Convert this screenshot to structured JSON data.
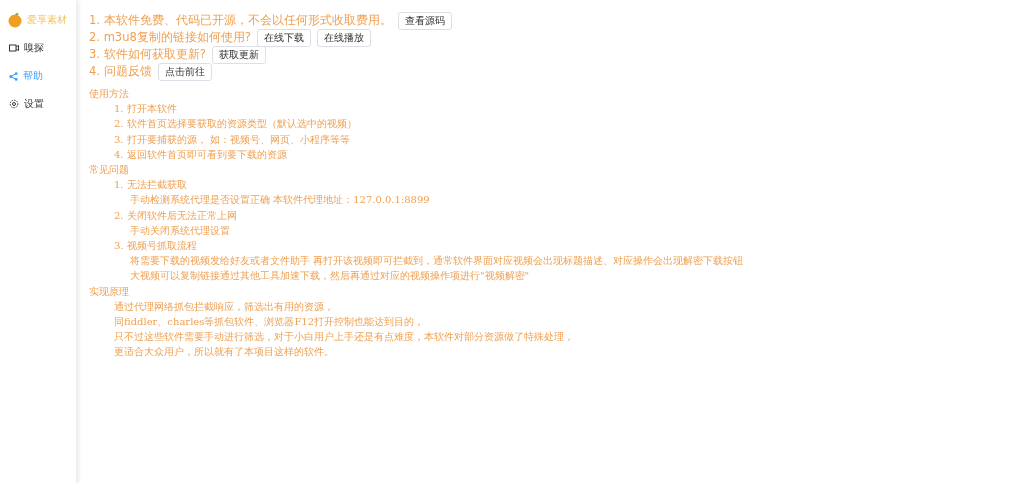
{
  "sidebar": {
    "logo_text": "爱享素材",
    "items": [
      {
        "label": "嗅探",
        "selected": false
      },
      {
        "label": "帮助",
        "selected": true
      },
      {
        "label": "设置",
        "selected": false
      }
    ]
  },
  "faq": [
    {
      "text": "1. 本软件免费、代码已开源，不会以任何形式收取费用。",
      "buttons": [
        "查看源码"
      ]
    },
    {
      "text": "2. m3u8复制的链接如何使用?",
      "buttons": [
        "在线下载",
        "在线播放"
      ]
    },
    {
      "text": "3. 软件如何获取更新?",
      "buttons": [
        "获取更新"
      ]
    },
    {
      "text": "4. 问题反馈",
      "buttons": [
        "点击前往"
      ]
    }
  ],
  "guide": [
    {
      "title": "使用方法",
      "items": [
        {
          "text": "1. 打开本软件"
        },
        {
          "text": "2. 软件首页选择要获取的资源类型（默认选中的视频）"
        },
        {
          "text": "3. 打开要捕获的源， 如：视频号、网页、小程序等等"
        },
        {
          "text": "4. 返回软件首页即可看到要下载的资源"
        }
      ]
    },
    {
      "title": "常见问题",
      "items": [
        {
          "text": "1. 无法拦截获取",
          "notes": [
            "手动检测系统代理是否设置正确 本软件代理地址：127.0.0.1:8899"
          ]
        },
        {
          "text": "2. 关闭软件后无法正常上网",
          "notes": [
            "手动关闭系统代理设置"
          ]
        },
        {
          "text": "3. 视频号抓取流程",
          "notes": [
            "将需要下载的视频发给好友或者文件助手 再打开该视频即可拦截到，通常软件界面对应视频会出现标题描述、对应操作会出现解密下载按钮",
            "大视频可以复制链接通过其他工具加速下载，然后再通过对应的视频操作项进行\"视频解密\""
          ]
        }
      ]
    },
    {
      "title": "实现原理",
      "lines": [
        "通过代理网络抓包拦截响应，筛选出有用的资源，",
        "同fiddler、charles等抓包软件、浏览器F12打开控制也能达到目的，",
        "只不过这些软件需要手动进行筛选，对于小白用户上手还是有点难度，本软件对部分资源做了特殊处理，",
        "更适合大众用户，所以就有了本项目这样的软件。"
      ]
    }
  ]
}
